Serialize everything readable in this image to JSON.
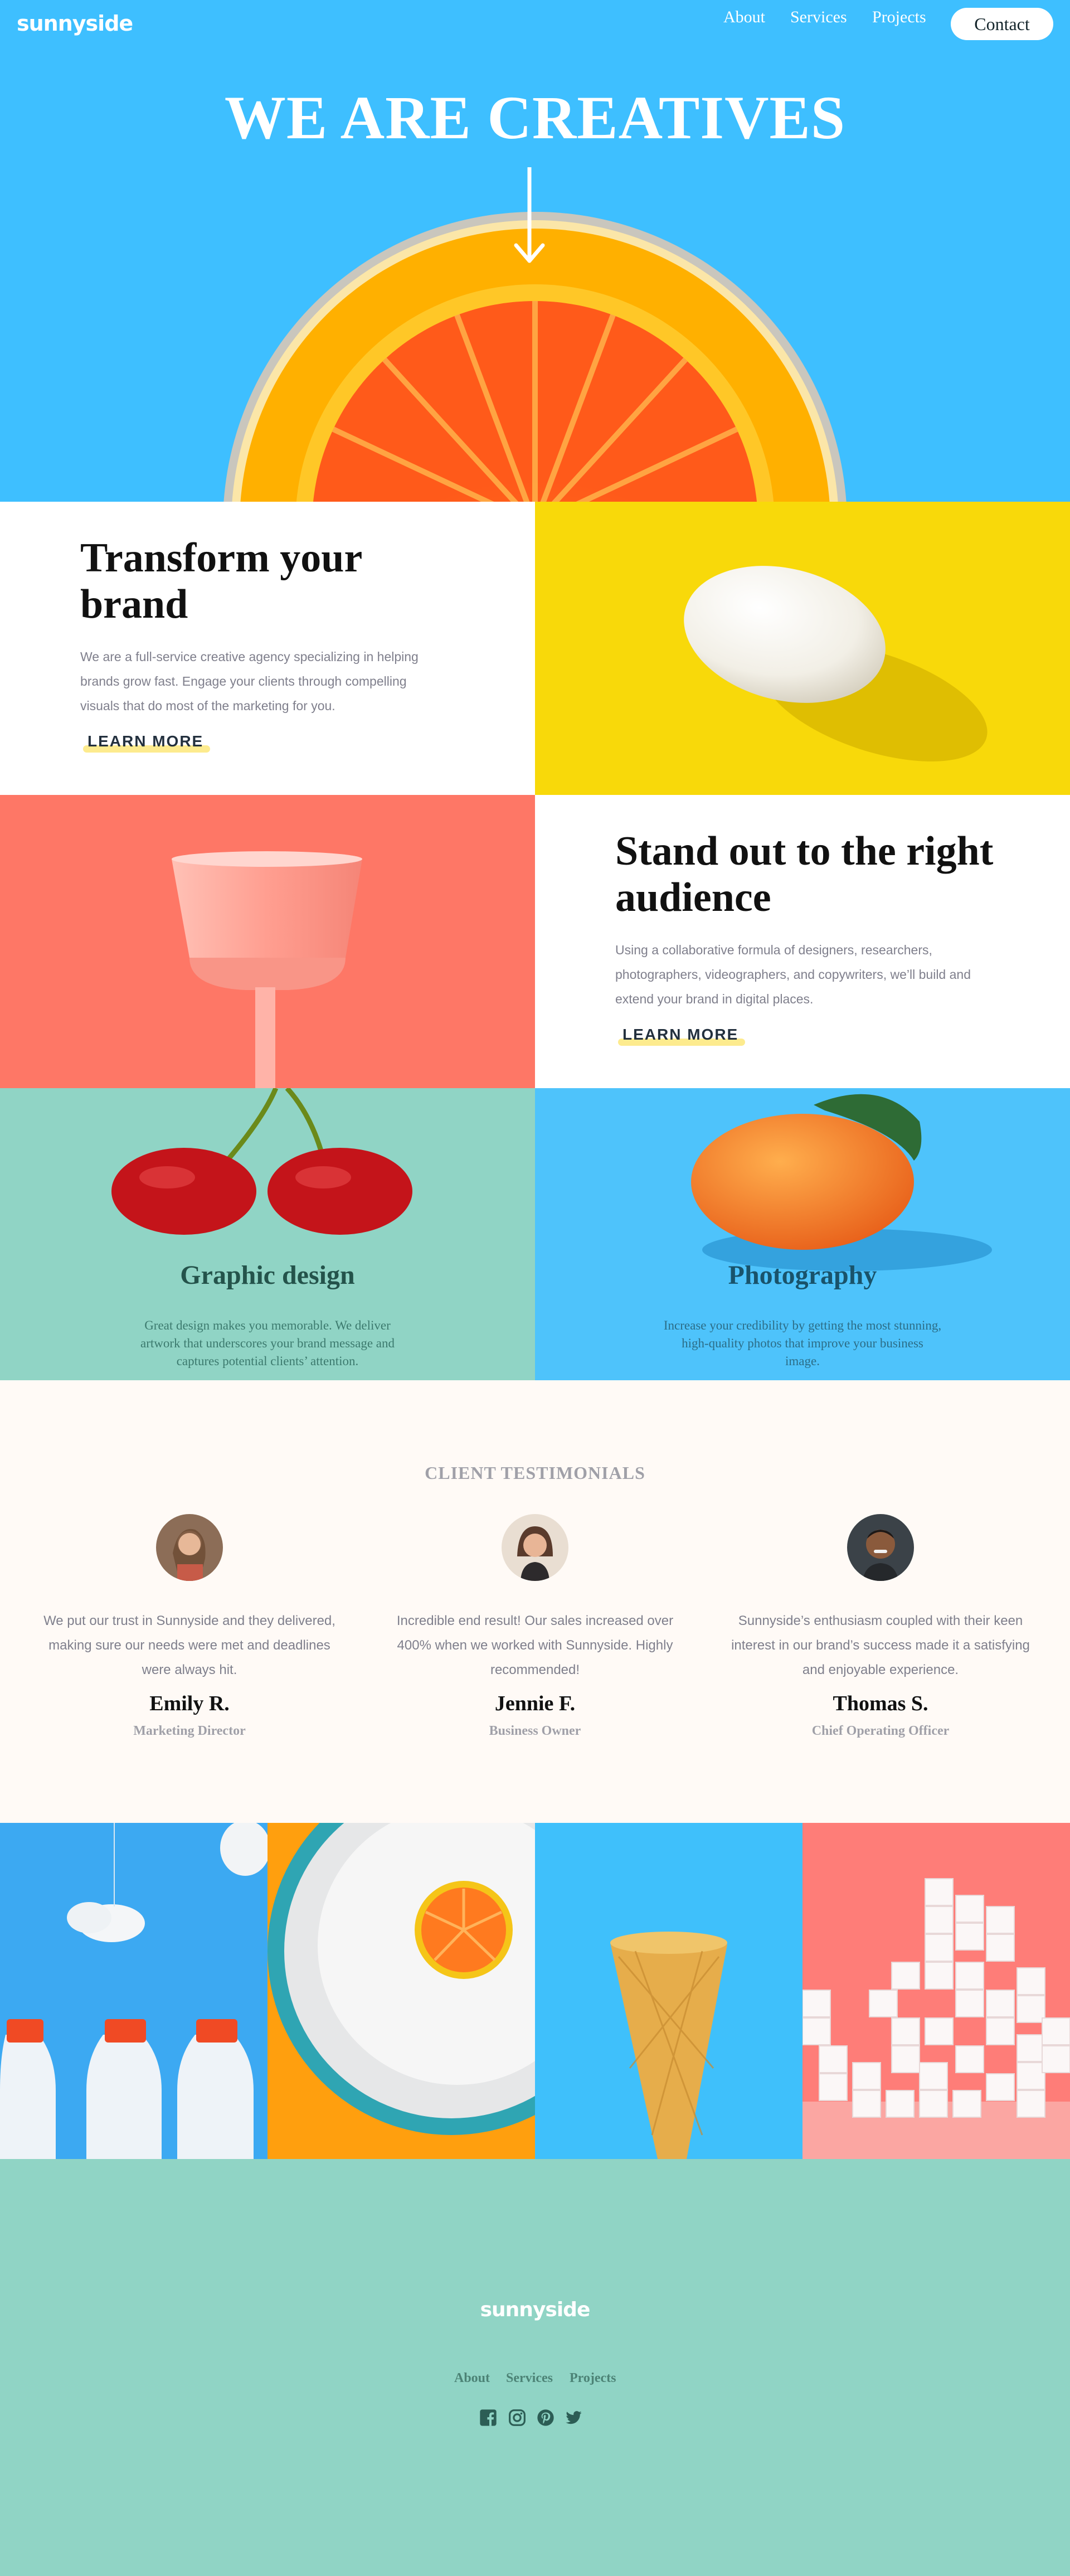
{
  "header": {
    "logo": "sunnyside",
    "nav": [
      "About",
      "Services",
      "Projects"
    ],
    "contact_label": "Contact"
  },
  "hero": {
    "title": "WE ARE CREATIVES"
  },
  "features": [
    {
      "title_line1": "Transform your",
      "title_line2": "brand",
      "body": "We are a full-service creative agency specializing in helping brands grow fast. Engage your clients through compelling visuals that do most of the marketing for you.",
      "cta": "LEARN MORE"
    },
    {
      "title_line1": "Stand out to the right",
      "title_line2": "audience",
      "body": "Using a collaborative formula of designers, researchers, photographers, videographers, and copywriters, we’ll build and extend your brand in digital places.",
      "cta": "LEARN MORE"
    }
  ],
  "services": [
    {
      "title": "Graphic design",
      "body": "Great design makes you memorable. We deliver artwork that underscores your brand message and captures potential clients’ attention."
    },
    {
      "title": "Photography",
      "body": "Increase your credibility by getting the most stunning, high-quality photos that improve your business image."
    }
  ],
  "testimonials": {
    "heading": "CLIENT TESTIMONIALS",
    "items": [
      {
        "quote": "We put our trust in Sunnyside and they delivered, making sure our needs were met and deadlines were always hit.",
        "name": "Emily R.",
        "role": "Marketing Director"
      },
      {
        "quote": "Incredible end result! Our sales increased over 400% when we worked with Sunnyside. Highly recommended!",
        "name": "Jennie F.",
        "role": "Business Owner"
      },
      {
        "quote": "Sunnyside’s enthusiasm coupled with their keen interest in our brand’s success made it a satisfying and enjoyable experience.",
        "name": "Thomas S.",
        "role": "Chief Operating Officer"
      }
    ]
  },
  "footer": {
    "logo": "sunnyside",
    "links": [
      "About",
      "Services",
      "Projects"
    ],
    "social_icons": [
      "facebook-icon",
      "instagram-icon",
      "pinterest-icon",
      "twitter-icon"
    ]
  },
  "colors": {
    "hero_blue": "#3ebfff",
    "egg_yellow": "#f8d90a",
    "coral": "#fe7766",
    "mint": "#90d4c5",
    "graphic_text": "#24534b",
    "photo_text": "#19536b",
    "cream": "#fffaf6"
  }
}
